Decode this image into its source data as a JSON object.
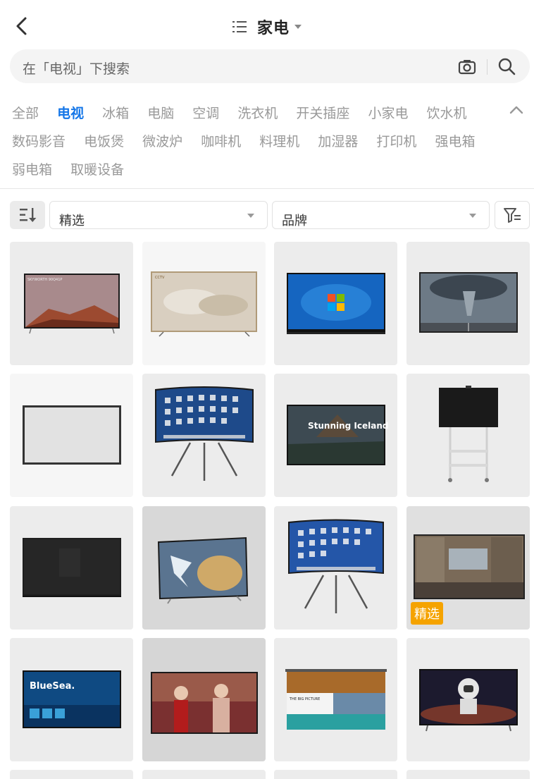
{
  "header": {
    "title": "家电"
  },
  "search": {
    "placeholder": "在「电视」下搜索"
  },
  "categories": {
    "row1": [
      "全部",
      "电视",
      "冰箱",
      "电脑",
      "空调",
      "洗衣机",
      "开关插座",
      "小家电",
      "饮水机"
    ],
    "row2": [
      "数码影音",
      "电饭煲",
      "微波炉",
      "咖啡机",
      "料理机",
      "加湿器",
      "打印机",
      "强电箱"
    ],
    "row3": [
      "弱电箱",
      "取暖设备"
    ],
    "active": "电视"
  },
  "filters": {
    "sort_select": "精选",
    "brand_select": "品牌"
  },
  "grid": {
    "badge": "精选",
    "items": [
      {
        "screen_text": "SKYWORTH 90Q41P"
      },
      {
        "screen_text": "CCTV"
      },
      {
        "screen_text": ""
      },
      {
        "screen_text": ""
      },
      {
        "screen_text": ""
      },
      {
        "screen_text": ""
      },
      {
        "screen_text": "Stunning Iceland"
      },
      {
        "screen_text": ""
      },
      {
        "screen_text": ""
      },
      {
        "screen_text": ""
      },
      {
        "screen_text": ""
      },
      {
        "screen_text": ""
      },
      {
        "screen_text": "BlueSea."
      },
      {
        "screen_text": ""
      },
      {
        "screen_text": "THE BIG PICTURE"
      },
      {
        "screen_text": ""
      }
    ]
  },
  "colors": {
    "accent": "#1476e8",
    "badge": "#f5a300"
  }
}
